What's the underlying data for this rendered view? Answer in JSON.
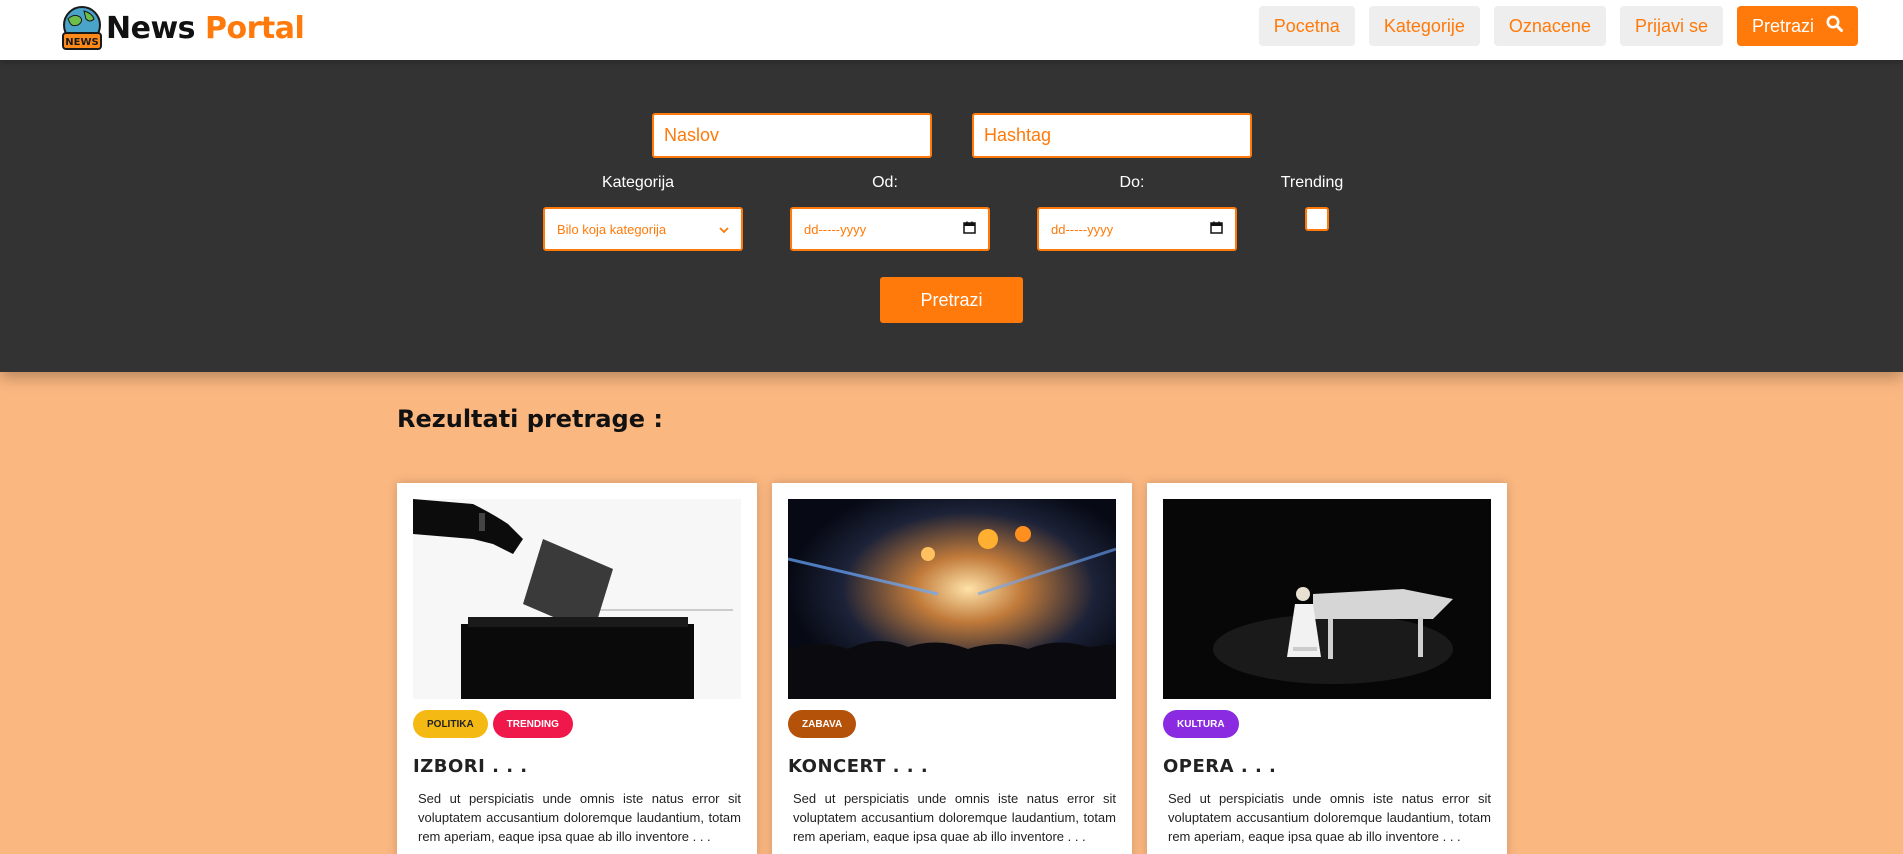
{
  "brand": {
    "word1": "News",
    "word2": "Portal",
    "badge": "NEWS"
  },
  "nav": {
    "items": [
      "Pocetna",
      "Kategorije",
      "Oznacene",
      "Prijavi se"
    ],
    "search_label": "Pretrazi"
  },
  "search": {
    "title_placeholder": "Naslov",
    "hashtag_placeholder": "Hashtag",
    "category_label": "Kategorija",
    "category_value": "Bilo koja kategorija",
    "from_label": "Od:",
    "from_placeholder": "dd-----yyyy",
    "to_label": "Do:",
    "to_placeholder": "dd-----yyyy",
    "trending_label": "Trending",
    "trending_checked": false,
    "submit_label": "Pretrazi"
  },
  "results": {
    "heading": "Rezultati pretrage :",
    "cards": [
      {
        "title": "IZBORI . . .",
        "tags": [
          {
            "label": "POLITIKA",
            "bg": "#f5b914",
            "fg": "#222222"
          },
          {
            "label": "TRENDING",
            "bg": "#f0174a",
            "fg": "#ffffff"
          }
        ],
        "text": "Sed ut perspiciatis unde omnis iste natus error sit voluptatem accusantium doloremque laudantium, totam rem aperiam, eaque ipsa quae ab illo inventore . . ."
      },
      {
        "title": "KONCERT . . .",
        "tags": [
          {
            "label": "ZABAVA",
            "bg": "#b4520a",
            "fg": "#ffffff"
          }
        ],
        "text": "Sed ut perspiciatis unde omnis iste natus error sit voluptatem accusantium doloremque laudantium, totam rem aperiam, eaque ipsa quae ab illo inventore . . ."
      },
      {
        "title": "OPERA . . .",
        "tags": [
          {
            "label": "KULTURA",
            "bg": "#8a2be2",
            "fg": "#ffffff"
          }
        ],
        "text": "Sed ut perspiciatis unde omnis iste natus error sit voluptatem accusantium doloremque laudantium, totam rem aperiam, eaque ipsa quae ab illo inventore . . ."
      }
    ]
  },
  "colors": {
    "accent": "#ff7a0a",
    "panel": "#333333",
    "page_bg": "#fbb780"
  }
}
